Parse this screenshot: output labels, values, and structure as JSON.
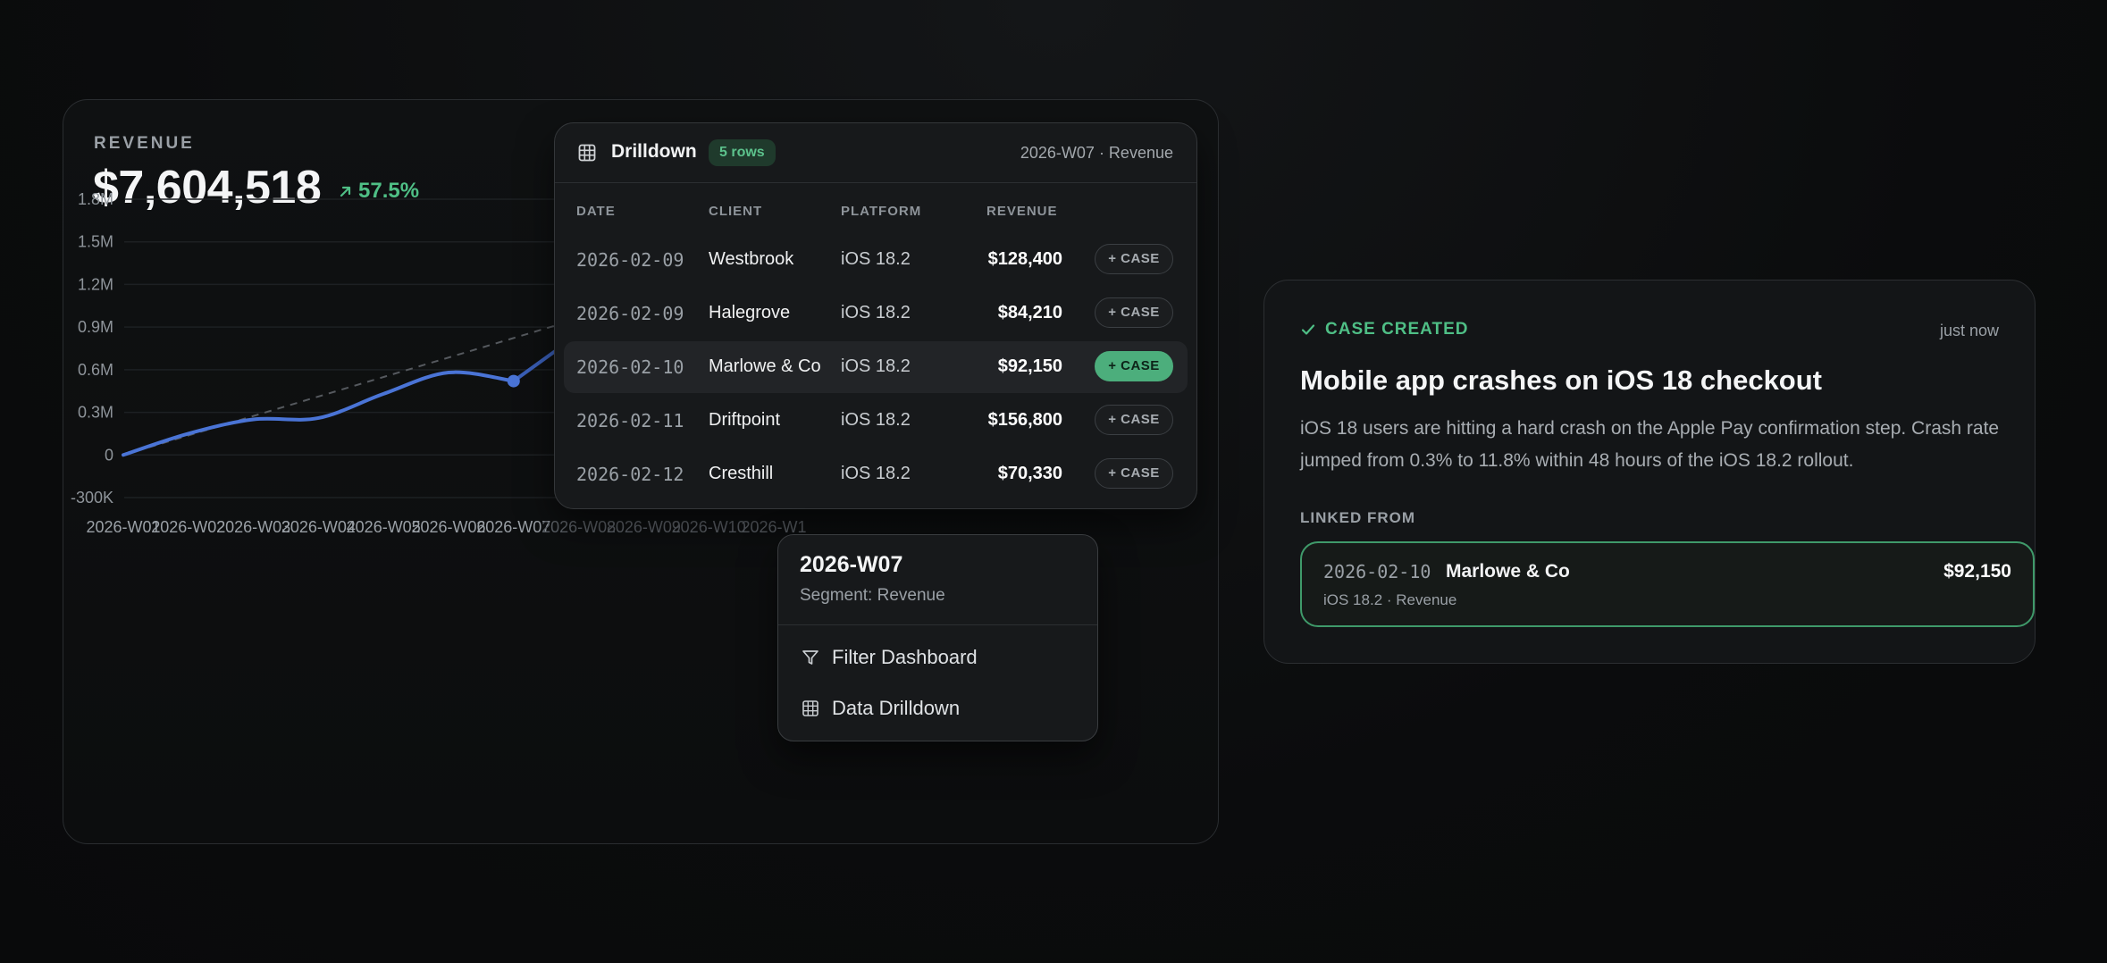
{
  "revenue": {
    "label": "REVENUE",
    "value": "$7,604,518",
    "delta": "57.5%",
    "colors": {
      "line": "#4a74d6",
      "delta": "#4fbf86"
    }
  },
  "chart_data": {
    "type": "line",
    "categories": [
      "2026-W01",
      "2026-W02",
      "2026-W03",
      "2026-W04",
      "2026-W05",
      "2026-W06",
      "2026-W07",
      "2026-W08",
      "2026-W09",
      "2026-W10",
      "2026-W1"
    ],
    "ytick_labels": [
      "1.8M",
      "1.5M",
      "1.2M",
      "0.9M",
      "0.6M",
      "0.3M",
      "0",
      "-300K"
    ],
    "yticks": [
      1800000,
      1500000,
      1200000,
      900000,
      600000,
      300000,
      0,
      -300000
    ],
    "ylim": [
      -300000,
      1800000
    ],
    "series": [
      {
        "values": [
          0,
          150000,
          250000,
          260000,
          430000,
          580000,
          520000,
          850000,
          null,
          null,
          null
        ]
      },
      {
        "style": "dashed",
        "values": [
          0,
          130000,
          260000,
          390000,
          530000,
          680000,
          820000,
          960000,
          null,
          null,
          null
        ]
      }
    ],
    "highlight_category": "2026-W07",
    "grid": true
  },
  "drilldown": {
    "title": "Drilldown",
    "badge": "5 rows",
    "meta": "2026-W07 · Revenue",
    "columns": [
      "DATE",
      "CLIENT",
      "PLATFORM",
      "REVENUE"
    ],
    "rows": [
      {
        "date": "2026-02-09",
        "client": "Westbrook",
        "platform": "iOS 18.2",
        "revenue": "$128,400",
        "action": "+ CASE"
      },
      {
        "date": "2026-02-09",
        "client": "Halegrove",
        "platform": "iOS 18.2",
        "revenue": "$84,210",
        "action": "+ CASE"
      },
      {
        "date": "2026-02-10",
        "client": "Marlowe & Co",
        "platform": "iOS 18.2",
        "revenue": "$92,150",
        "action": "+ CASE"
      },
      {
        "date": "2026-02-11",
        "client": "Driftpoint",
        "platform": "iOS 18.2",
        "revenue": "$156,800",
        "action": "+ CASE"
      },
      {
        "date": "2026-02-12",
        "client": "Cresthill",
        "platform": "iOS 18.2",
        "revenue": "$70,330",
        "action": "+ CASE"
      }
    ]
  },
  "context_menu": {
    "title": "2026-W07",
    "subtitle": "Segment: Revenue",
    "items": [
      {
        "label": "Filter Dashboard",
        "icon": "filter-icon"
      },
      {
        "label": "Data Drilldown",
        "icon": "table-icon"
      }
    ]
  },
  "case_card": {
    "status": "CASE CREATED",
    "time": "just now",
    "title": "Mobile app crashes on iOS 18 checkout",
    "description": "iOS 18 users are hitting a hard crash on the Apple Pay confirmation step. Crash rate jumped from 0.3% to 11.8% within 48 hours of the iOS 18.2 rollout.",
    "linked_label": "LINKED FROM",
    "linked": {
      "date": "2026-02-10",
      "client": "Marlowe & Co",
      "amount": "$92,150",
      "meta": "iOS 18.2 · Revenue"
    },
    "colors": {
      "accent": "#4fbf86"
    }
  }
}
